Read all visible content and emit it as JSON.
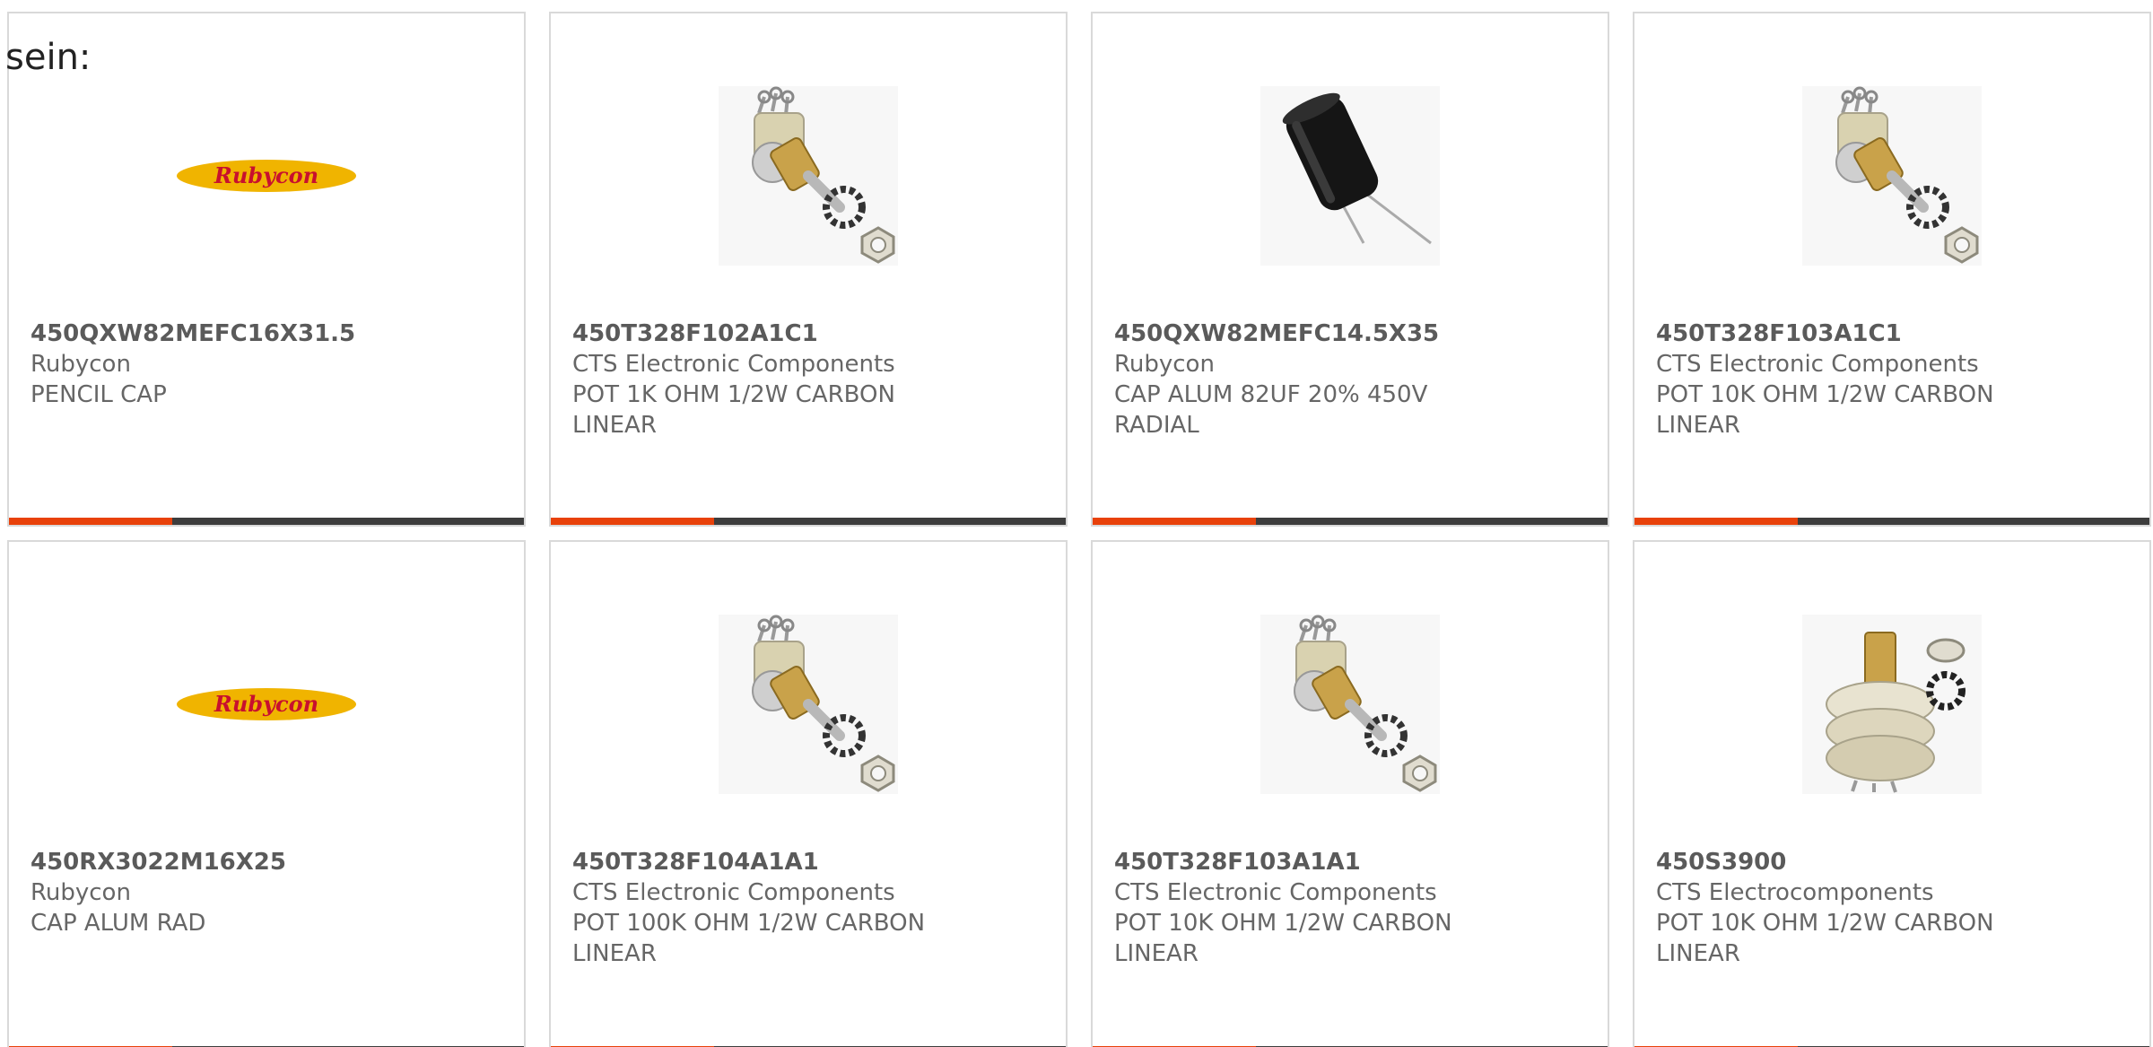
{
  "intro_text": "sein:",
  "colors": {
    "accent": "#e8410a",
    "bar": "#3d3d3d",
    "rubycon_yellow": "#f0b400",
    "rubycon_red": "#c8102e"
  },
  "products": [
    {
      "part_number": "450QXW82MEFC16X31.5",
      "manufacturer": "Rubycon",
      "description": "PENCIL CAP",
      "image": "rubycon-logo"
    },
    {
      "part_number": "450T328F102A1C1",
      "manufacturer": "CTS Electronic Components",
      "description": "POT 1K OHM 1/2W CARBON LINEAR",
      "image": "potentiometer"
    },
    {
      "part_number": "450QXW82MEFC14.5X35",
      "manufacturer": "Rubycon",
      "description": "CAP ALUM 82UF 20% 450V RADIAL",
      "image": "capacitor"
    },
    {
      "part_number": "450T328F103A1C1",
      "manufacturer": "CTS Electronic Components",
      "description": "POT 10K OHM 1/2W CARBON LINEAR",
      "image": "potentiometer"
    },
    {
      "part_number": "450RX3022M16X25",
      "manufacturer": "Rubycon",
      "description": "CAP ALUM RAD",
      "image": "rubycon-logo"
    },
    {
      "part_number": "450T328F104A1A1",
      "manufacturer": "CTS Electronic Components",
      "description": "POT 100K OHM 1/2W CARBON LINEAR",
      "image": "potentiometer"
    },
    {
      "part_number": "450T328F103A1A1",
      "manufacturer": "CTS Electronic Components",
      "description": "POT 10K OHM 1/2W CARBON LINEAR",
      "image": "potentiometer"
    },
    {
      "part_number": "450S3900",
      "manufacturer": "CTS Electrocomponents",
      "description": "POT 10K OHM 1/2W CARBON LINEAR",
      "image": "dual-potentiometer"
    }
  ],
  "logo_text": "Rubycon"
}
